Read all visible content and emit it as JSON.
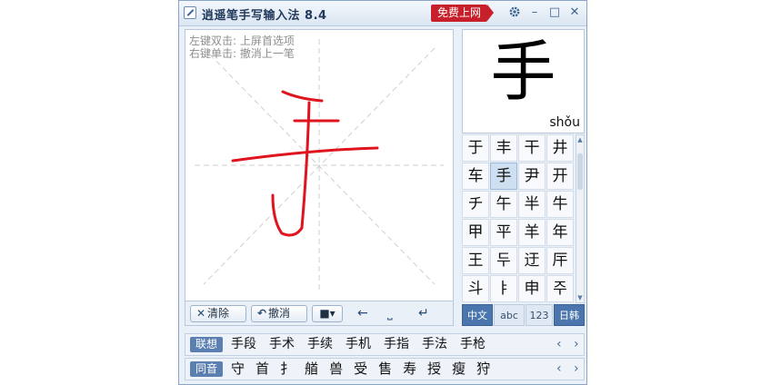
{
  "app": {
    "title": "逍遥笔手写输入法 8.4",
    "promo_label": "免费上网",
    "settings_icon": "gear-icon",
    "min_label": "–",
    "max_label": "□",
    "close_label": "✕"
  },
  "canvas": {
    "hint_line1": "左键双击: 上屏首选项",
    "hint_line2": "右键单击: 撤消上一笔",
    "stroke_color": "#e0141e"
  },
  "toolbar": {
    "clear_label": "清除",
    "undo_label": "撤消",
    "clear_icon": "✕",
    "undo_icon": "↶",
    "camera_icon": "■▾",
    "backspace_icon": "←",
    "space_icon": "⎵",
    "enter_icon": "↵"
  },
  "preview": {
    "char": "手",
    "pinyin": "shǒu"
  },
  "candidates": [
    [
      "于",
      "丰",
      "干",
      "井"
    ],
    [
      "车",
      "手",
      "尹",
      "开"
    ],
    [
      "チ",
      "午",
      "半",
      "牛"
    ],
    [
      "甲",
      "平",
      "羊",
      "年"
    ],
    [
      "王",
      "두",
      "迂",
      "厈"
    ],
    [
      "斗",
      "ㅑ",
      "申",
      "주"
    ]
  ],
  "selected_candidate": "手",
  "modes": {
    "chinese": "中文",
    "abc": "abc",
    "numbers": "123",
    "jp_kr": "日韩"
  },
  "association": {
    "label": "联想",
    "items": [
      "手段",
      "手术",
      "手续",
      "手机",
      "手指",
      "手法",
      "手枪"
    ],
    "prev": "‹",
    "next": "›"
  },
  "homophones": {
    "label": "同音",
    "items": [
      "守",
      "首",
      "扌",
      "艏",
      "兽",
      "受",
      "售",
      "寿",
      "授",
      "瘦",
      "狩"
    ],
    "prev": "‹",
    "next": "›"
  }
}
